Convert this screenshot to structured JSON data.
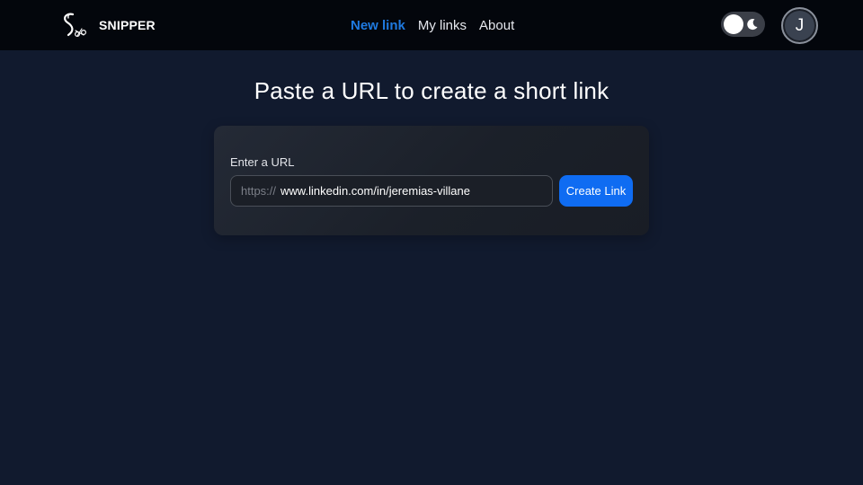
{
  "app": {
    "name": "SNIPPER",
    "logo_icon": "scissors-s-logo-icon"
  },
  "nav": {
    "links": [
      {
        "label": "New link",
        "active": true
      },
      {
        "label": "My links",
        "active": false
      },
      {
        "label": "About",
        "active": false
      }
    ]
  },
  "header": {
    "theme_toggle": {
      "mode": "dark",
      "icon": "moon-icon"
    },
    "avatar_initial": "J"
  },
  "main": {
    "title": "Paste a URL to create a short link",
    "form": {
      "label": "Enter a URL",
      "prefix": "https://",
      "url_value": "www.linkedin.com/in/jeremias-villane",
      "submit_label": "Create Link"
    }
  },
  "colors": {
    "background": "#111a2e",
    "navbar": "#03060c",
    "accent": "#1f7ae0",
    "button": "#0f6cf2"
  }
}
